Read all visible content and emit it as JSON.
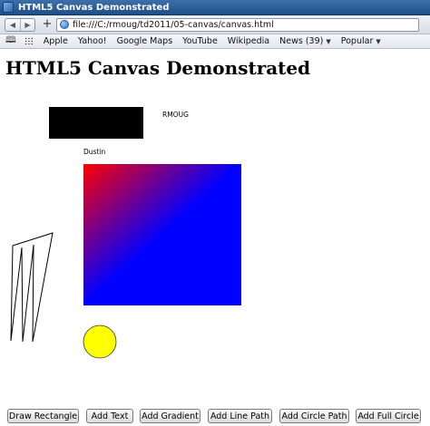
{
  "window": {
    "title": "HTML5 Canvas Demonstrated"
  },
  "toolbar": {
    "back_icon": "back-arrow-icon",
    "forward_icon": "forward-arrow-icon",
    "new_tab_label": "+",
    "url": "file:///C:/rmoug/td2011/05-canvas/canvas.html"
  },
  "bookmarks": {
    "items": [
      "Apple",
      "Yahoo!",
      "Google Maps",
      "YouTube",
      "Wikipedia",
      "News (39)",
      "Popular"
    ]
  },
  "page": {
    "heading": "HTML5 Canvas Demonstrated",
    "canvas": {
      "text_rmoug": "RMOUG",
      "text_dustin": "Dustin",
      "rect_color": "#000000",
      "gradient_start": "#ff0000",
      "gradient_end": "#0000ff",
      "circle_fill": "#ffff00",
      "line_color": "#000000"
    },
    "buttons": [
      "Draw Rectangle",
      "Add Text",
      "Add Gradient",
      "Add Line Path",
      "Add Circle Path",
      "Add Full Circle"
    ]
  }
}
